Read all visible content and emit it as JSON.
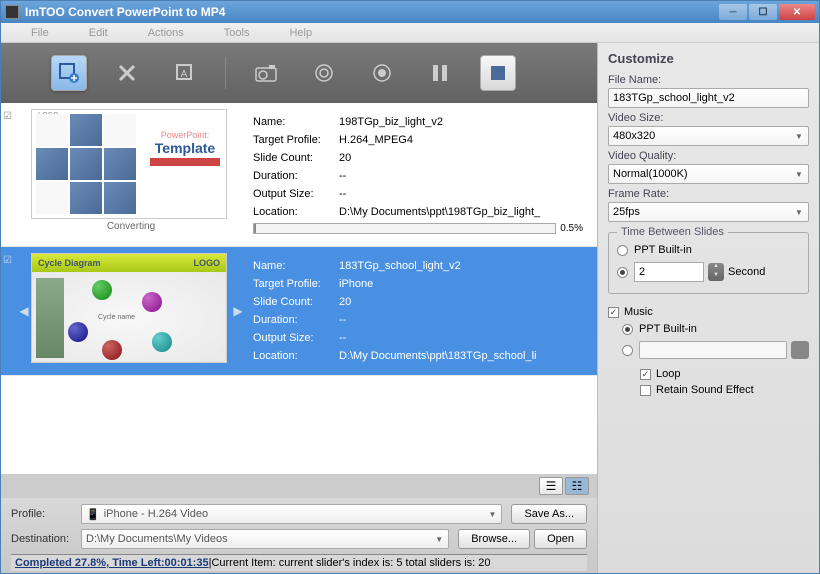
{
  "titlebar": {
    "title": "ImTOO Convert PowerPoint to MP4"
  },
  "menu": {
    "file": "File",
    "edit": "Edit",
    "actions": "Actions",
    "tools": "Tools",
    "help": "Help"
  },
  "items": [
    {
      "caption": "Converting",
      "name_label": "Name:",
      "name": "198TGp_biz_light_v2",
      "profile_label": "Target Profile:",
      "profile": "H.264_MPEG4",
      "slide_label": "Slide Count:",
      "slide": "20",
      "duration_label": "Duration:",
      "duration": "--",
      "output_label": "Output Size:",
      "output": "--",
      "location_label": "Location:",
      "location": "D:\\My Documents\\ppt\\198TGp_biz_light_",
      "progress_pct": "0.5%",
      "thumb_title": "Template",
      "thumb_sub": "PowerPoint:",
      "thumb_logo": "LOGO"
    },
    {
      "caption": "",
      "name_label": "Name:",
      "name": "183TGp_school_light_v2",
      "profile_label": "Target Profile:",
      "profile": "iPhone",
      "slide_label": "Slide Count:",
      "slide": "20",
      "duration_label": "Duration:",
      "duration": "--",
      "output_label": "Output Size:",
      "output": "--",
      "location_label": "Location:",
      "location": "D:\\My Documents\\ppt\\183TGp_school_li",
      "thumb_hdr": "Cycle Diagram",
      "thumb_logo": "LOGO",
      "thumb_center": "Cycle name"
    }
  ],
  "bottom": {
    "profile_label": "Profile:",
    "profile_value": "iPhone - H.264 Video",
    "saveas": "Save As...",
    "dest_label": "Destination:",
    "dest_value": "D:\\My Documents\\My Videos",
    "browse": "Browse...",
    "open": "Open"
  },
  "status": {
    "bold": "Completed 27.8%, Time Left:00:01:35",
    "rest": "|Current Item: current slider's index is: 5 total sliders is: 20"
  },
  "side": {
    "title": "Customize",
    "filename_label": "File Name:",
    "filename": "183TGp_school_light_v2",
    "videosize_label": "Video Size:",
    "videosize": "480x320",
    "videoquality_label": "Video Quality:",
    "videoquality": "Normal(1000K)",
    "framerate_label": "Frame Rate:",
    "framerate": "25fps",
    "time_group": "Time Between Slides",
    "ppt_builtin": "PPT Built-in",
    "seconds_val": "2",
    "seconds_unit": "Second",
    "music": "Music",
    "loop": "Loop",
    "retain": "Retain Sound Effect"
  }
}
